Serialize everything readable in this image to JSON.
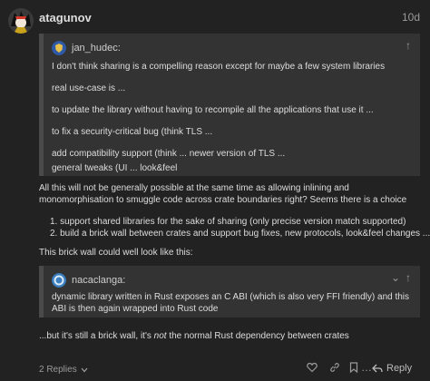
{
  "post": {
    "author": "atagunov",
    "date": "10d",
    "quotes": [
      {
        "author": "jan_hudec:",
        "lines": [
          "I don't think sharing is a compelling reason except for maybe a few system libraries",
          "real use-case is ...",
          "to update the library without having to recompile all the applications that use it ...",
          "to fix a security-critical bug (think TLS ...",
          "add compatibility support (think ... newer version of TLS ...",
          "general tweaks (UI ... look&feel"
        ]
      },
      {
        "author": "nacaclanga:",
        "text": "dynamic library written in Rust exposes an C ABI (which is also very FFI friendly) and this ABI is then again wrapped into Rust code"
      }
    ],
    "paragraph_1": "All this will not be generally possible at the same time as allowing inlining and monomorphisation to smuggle code across crate boundaries right? Seems there is a choice",
    "list": [
      "1. support shared libraries for the sake of sharing (only precise version match supported)",
      "2. build a brick wall between crates and support bug fixes, new protocols, look&feel changes ..."
    ],
    "paragraph_2": "This brick wall could well look like this:",
    "closing": {
      "before": "...but it's still a brick wall, it's ",
      "emphasis": "not",
      "after": " the normal Rust dependency between crates"
    }
  },
  "footer": {
    "replies_label": "2 Replies",
    "reply_label": "Reply"
  },
  "colors": {
    "background": "#222222",
    "quote_background": "#333333",
    "quote_border": "#4a4a4a",
    "text": "#dddddd",
    "muted": "#9a9a9a"
  },
  "icons": {
    "avatar": "anime-character-avatar",
    "quote_avatar_1": "shield-avatar",
    "quote_avatar_2": "ring-avatar",
    "quote_actions": [
      "chevron-down-icon",
      "arrow-up-icon"
    ],
    "footer_actions": [
      "heart-icon",
      "link-icon",
      "bookmark-icon",
      "more-icon",
      "reply-icon"
    ]
  }
}
